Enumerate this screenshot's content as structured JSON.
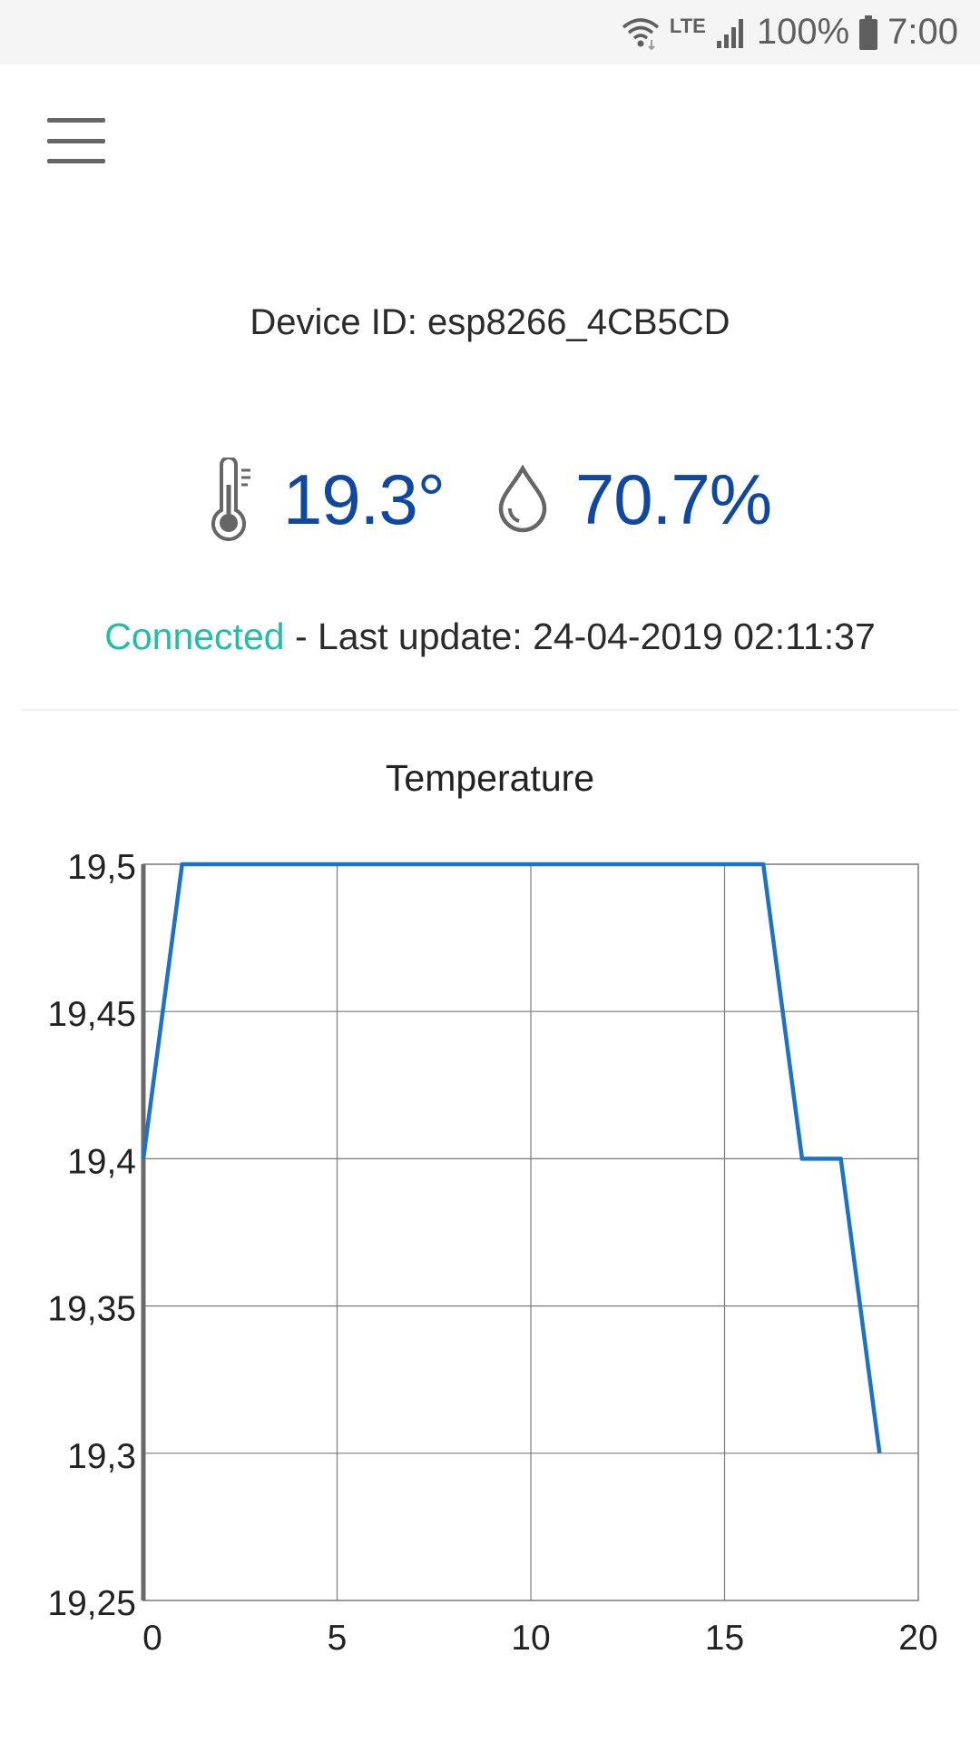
{
  "status_bar": {
    "network": "LTE",
    "battery": "100%",
    "time": "7:00"
  },
  "header": {
    "menu_icon": "hamburger-menu-icon"
  },
  "device": {
    "label": "Device ID: esp8266_4CB5CD"
  },
  "readings": {
    "temperature": "19.3°",
    "humidity": "70.7%",
    "temperature_icon": "thermometer-icon",
    "humidity_icon": "water-drop-icon"
  },
  "connection": {
    "status": "Connected",
    "separator": " - ",
    "last_update": "Last update: 24-04-2019 02:11:37"
  },
  "colors": {
    "value_blue": "#0f48a3",
    "connected_green": "#1fbfa3",
    "line_blue": "#1a73c7"
  },
  "chart_data": {
    "type": "line",
    "title": "Temperature",
    "x": [
      0,
      1,
      16,
      17,
      18,
      19
    ],
    "series": [
      {
        "values": [
          19.4,
          19.5,
          19.5,
          19.4,
          19.4,
          19.3
        ]
      }
    ],
    "xlim": [
      0,
      20
    ],
    "ylim": [
      19.25,
      19.5
    ],
    "x_ticks": [
      "0",
      "5",
      "10",
      "15",
      "20"
    ],
    "y_ticks": [
      "19,25",
      "19,3",
      "19,35",
      "19,4",
      "19,45",
      "19,5"
    ],
    "grid": true
  }
}
